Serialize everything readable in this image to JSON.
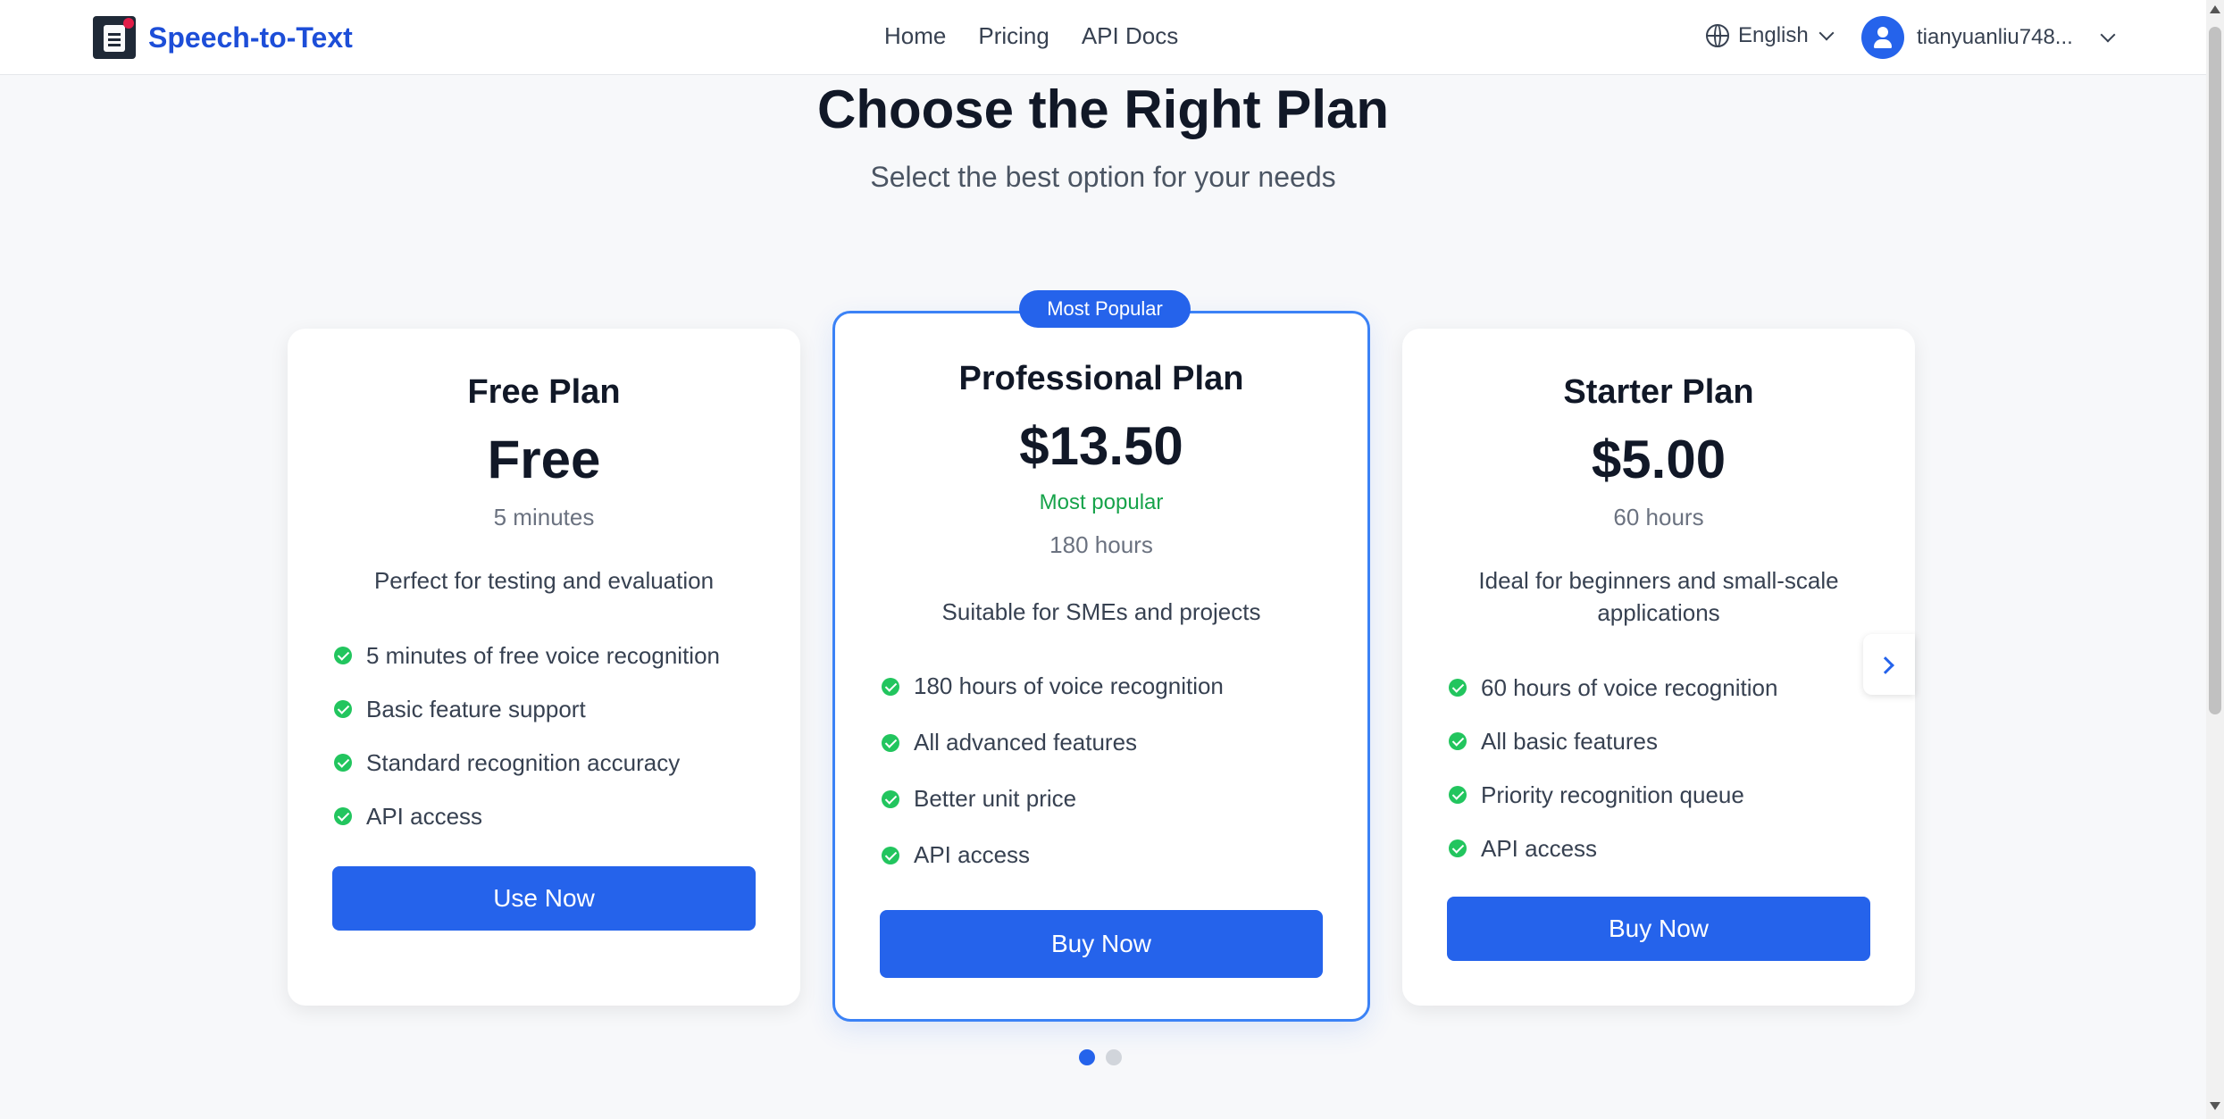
{
  "header": {
    "brand": "Speech-to-Text",
    "nav": [
      "Home",
      "Pricing",
      "API Docs"
    ],
    "language": "English",
    "user": "tianyuanliu748..."
  },
  "page": {
    "title": "Choose the Right Plan",
    "subtitle": "Select the best option for your needs"
  },
  "plans": [
    {
      "name": "Free Plan",
      "price": "Free",
      "duration": "5 minutes",
      "description": "Perfect for testing and evaluation",
      "features": [
        "5 minutes of free voice recognition",
        "Basic feature support",
        "Standard recognition accuracy",
        "API access"
      ],
      "cta": "Use Now"
    },
    {
      "badge": "Most Popular",
      "name": "Professional Plan",
      "price": "$13.50",
      "tag": "Most popular",
      "duration": "180 hours",
      "description": "Suitable for SMEs and projects",
      "features": [
        "180 hours of voice recognition",
        "All advanced features",
        "Better unit price",
        "API access"
      ],
      "cta": "Buy Now"
    },
    {
      "name": "Starter Plan",
      "price": "$5.00",
      "duration": "60 hours",
      "description": "Ideal for beginners and small-scale applications",
      "features": [
        "60 hours of voice recognition",
        "All basic features",
        "Priority recognition queue",
        "API access"
      ],
      "cta": "Buy Now"
    }
  ],
  "carousel": {
    "current_page": 1,
    "total_pages": 2
  },
  "colors": {
    "primary": "#2563eb",
    "success": "#22c55e",
    "brand_text": "#1d4ed8"
  }
}
